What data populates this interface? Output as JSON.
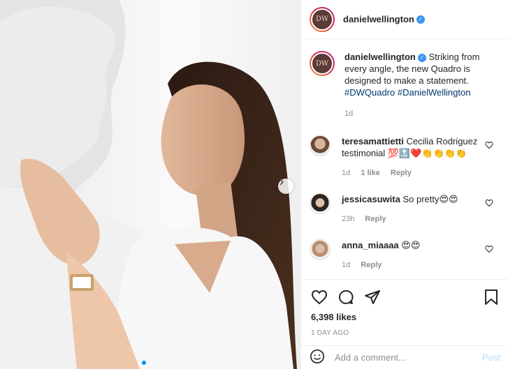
{
  "post": {
    "account": {
      "username": "danielwellington",
      "avatar_text": "DW",
      "verified_mark": "✓"
    },
    "caption": {
      "text": "Striking from every angle, the new Quadro is designed to make a statement.",
      "hashtags": [
        "#DWQuadro",
        "#DanielWellington"
      ],
      "age": "1d"
    },
    "comments": [
      {
        "username": "teresamattietti",
        "text": "Cecilia Rodriguez testimonial 💯🔝❤️👏👏👏👏",
        "age": "1d",
        "likes": "1 like",
        "reply": "Reply"
      },
      {
        "username": "jessicasuwita",
        "text": "So pretty😍😍",
        "age": "23h",
        "reply": "Reply"
      },
      {
        "username": "anna_miaaaa",
        "text": "😍😍",
        "age": "1d",
        "reply": "Reply"
      }
    ],
    "likes": "6,398 likes",
    "posted": "1 DAY AGO",
    "add_comment": {
      "placeholder": "Add a comment...",
      "post_label": "Post"
    },
    "carousel": {
      "slides": 2,
      "current": 1
    },
    "colors": {
      "accent": "#0095f6",
      "link": "#00376b",
      "muted": "#8e8e8e",
      "heart": "#ed4956"
    },
    "icons": [
      "emoji-icon",
      "heart-icon",
      "comment-icon",
      "share-icon",
      "save-icon",
      "chevron-right-icon"
    ]
  }
}
